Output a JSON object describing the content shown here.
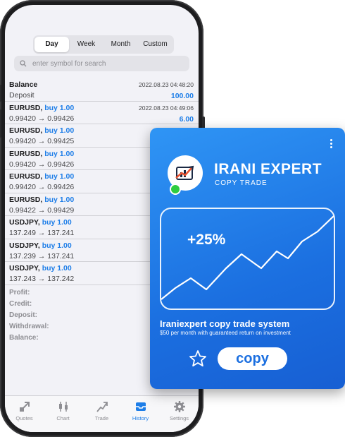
{
  "period_tabs": [
    {
      "label": "Day",
      "active": true
    },
    {
      "label": "Week",
      "active": false
    },
    {
      "label": "Month",
      "active": false
    },
    {
      "label": "Custom",
      "active": false
    }
  ],
  "search": {
    "placeholder": "enter symbol for search"
  },
  "history": [
    {
      "symbol": "Balance",
      "side": "",
      "date": "2022.08.23 04:48:20",
      "detail": "Deposit",
      "amount": "100.00"
    },
    {
      "symbol": "EURUSD,",
      "side": "buy 1.00",
      "date": "2022.08.23 04:49:06",
      "detail": "0.99420 → 0.99426",
      "amount": "6.00"
    },
    {
      "symbol": "EURUSD,",
      "side": "buy 1.00",
      "date": "",
      "detail": "0.99420 → 0.99425",
      "amount": ""
    },
    {
      "symbol": "EURUSD,",
      "side": "buy 1.00",
      "date": "",
      "detail": "0.99420 → 0.99426",
      "amount": ""
    },
    {
      "symbol": "EURUSD,",
      "side": "buy 1.00",
      "date": "",
      "detail": "0.99420 → 0.99426",
      "amount": ""
    },
    {
      "symbol": "EURUSD,",
      "side": "buy 1.00",
      "date": "",
      "detail": "0.99422 → 0.99429",
      "amount": ""
    },
    {
      "symbol": "USDJPY,",
      "side": "buy 1.00",
      "date": "",
      "detail": "137.249 → 137.241",
      "amount": ""
    },
    {
      "symbol": "USDJPY,",
      "side": "buy 1.00",
      "date": "",
      "detail": "137.239 → 137.241",
      "amount": ""
    },
    {
      "symbol": "USDJPY,",
      "side": "buy 1.00",
      "date": "",
      "detail": "137.243 → 137.242",
      "amount": ""
    }
  ],
  "summary": [
    "Profit:",
    "Credit:",
    "Deposit:",
    "Withdrawal:",
    "Balance:"
  ],
  "tabbar": [
    {
      "label": "Quotes",
      "icon": "quotes-icon",
      "active": false
    },
    {
      "label": "Chart",
      "icon": "candlestick-icon",
      "active": false
    },
    {
      "label": "Trade",
      "icon": "trade-icon",
      "active": false
    },
    {
      "label": "History",
      "icon": "inbox-icon",
      "active": true
    },
    {
      "label": "Settings",
      "icon": "gear-icon",
      "active": false
    }
  ],
  "card": {
    "brand": "IRANI EXPERT",
    "subtitle": "COPY TRADE",
    "gain": "+25%",
    "title": "Iraniexpert copy trade system",
    "description": "$50 per month with guaranteed return on investment",
    "copy_label": "copy"
  },
  "colors": {
    "accent": "#1e7ee8",
    "card_blue": "#1b6fe0",
    "online": "#2ecc40"
  }
}
